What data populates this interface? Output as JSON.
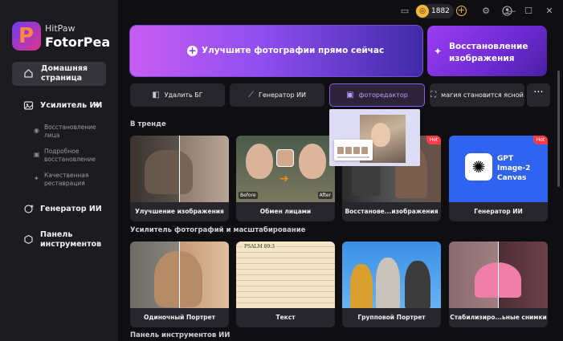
{
  "titlebar": {
    "credits": "1882",
    "icons": [
      "chat-icon",
      "coin-icon",
      "add-credits-icon",
      "settings-icon",
      "account-icon",
      "menu-icon",
      "minimize-icon",
      "maximize-icon",
      "close-icon"
    ]
  },
  "brand": {
    "top": "HitPaw",
    "name": "FotorPea"
  },
  "sidebar": {
    "home": "Домашняя страница",
    "enhancer": "Усилитель ИИ",
    "enhancer_items": [
      "Восстановление лица",
      "Подробное восстановление",
      "Качественная реставрация"
    ],
    "generator": "Генератор ИИ",
    "tools": "Панель инструментов"
  },
  "hero": {
    "label": "Улучшите фотографии прямо сейчас"
  },
  "restore": {
    "label": "Восстановление изображения"
  },
  "tools": [
    {
      "label": "Удалить БГ"
    },
    {
      "label": "Генератор ИИ"
    },
    {
      "label": "фоторедактор"
    },
    {
      "label": "магия становится ясной"
    }
  ],
  "sections": {
    "trending": "В тренде",
    "enhancer": "Усилитель фотографий и масштабирование",
    "toolbox": "Панель инструментов ИИ"
  },
  "trending_cards": [
    {
      "label": "Улучшение изображения"
    },
    {
      "label": "Обмен лицами",
      "before": "Before",
      "after": "After"
    },
    {
      "label": "Восстанове...изображения",
      "hot": "Hot"
    },
    {
      "label": "Генератор ИИ",
      "hot": "Hot",
      "gpt_title": "GPT",
      "gpt_sub": "Image-2",
      "gpt_sub2": "Canvas"
    }
  ],
  "enhancer_cards": [
    {
      "label": "Одиночный Портрет"
    },
    {
      "label": "Текст",
      "psalm": "PSALM 89:3"
    },
    {
      "label": "Групповой Портрет"
    },
    {
      "label": "Стабилизиро...ьные снимки"
    }
  ],
  "colors": {
    "accent": "#8a5cf0",
    "hot": "#ff3b4a",
    "coin": "#f5b93a",
    "gpt_blue": "#2f63f0"
  }
}
